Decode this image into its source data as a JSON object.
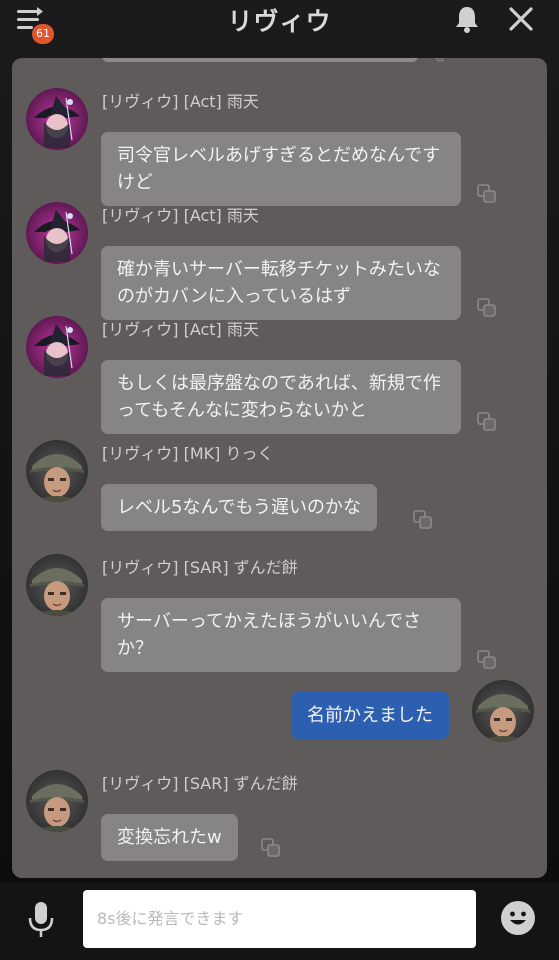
{
  "header": {
    "title": "リヴィウ",
    "menu_badge": "61",
    "menu_icon": "menu-list-icon",
    "bell_icon": "bell-icon",
    "close_icon": "close-icon"
  },
  "messages": [
    {
      "sender": "[リヴィウ] [Act] 雨天",
      "text": "司令官レベルあげすぎるとだめなんですけど",
      "avatar": "witch-avatar"
    },
    {
      "sender": "[リヴィウ] [Act] 雨天",
      "text": "確か青いサーバー転移チケットみたいなのがカバンに入っているはず",
      "avatar": "witch-avatar"
    },
    {
      "sender": "[リヴィウ] [Act] 雨天",
      "text": "もしくは最序盤なのであれば、新規で作ってもそんなに変わらないかと",
      "avatar": "witch-avatar"
    },
    {
      "sender": "[リヴィウ] [MK] りっく",
      "text": "レベル5なんでもう遅いのかな",
      "avatar": "soldier-avatar"
    },
    {
      "sender": "[リヴィウ] [SAR] ずんだ餅",
      "text": "サーバーってかえたほうがいいんでさか？",
      "avatar": "soldier-avatar"
    },
    {
      "sender": "",
      "text": "名前かえました",
      "avatar": "soldier-avatar",
      "self": true
    },
    {
      "sender": "[リヴィウ] [SAR] ずんだ餅",
      "text": "変換忘れたw",
      "avatar": "soldier-avatar"
    }
  ],
  "input": {
    "placeholder": "8s後に発言できます"
  },
  "colors": {
    "panel_bg": "#5f5b5b",
    "bubble_bg": "#878484",
    "self_bubble_bg": "#2c5faf",
    "badge": "#e0552b"
  },
  "icons": {
    "mic": "microphone-icon",
    "emoji": "smiley-icon",
    "copy": "copy-icon"
  }
}
